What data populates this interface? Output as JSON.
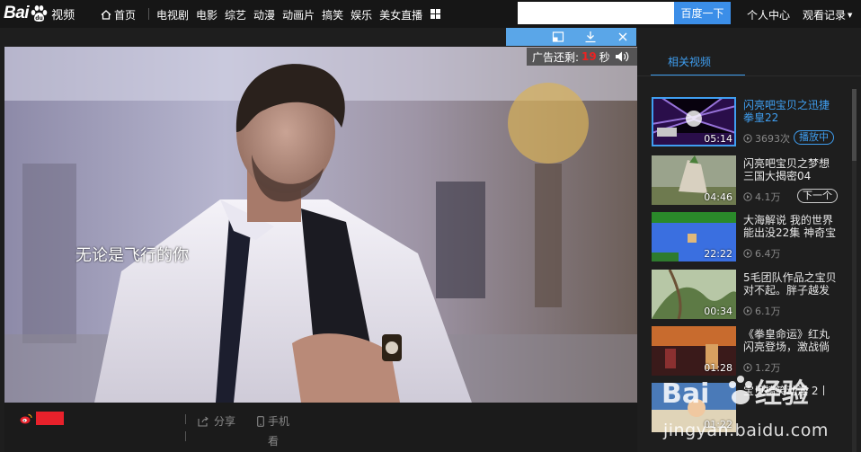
{
  "header": {
    "logo_text": "Bai",
    "logo_suffix": "视频",
    "home_label": "首页",
    "nav": [
      "电视剧",
      "电影",
      "综艺",
      "动漫",
      "动画片",
      "搞笑",
      "娱乐",
      "美女直播"
    ],
    "search_placeholder": "",
    "search_button": "百度一下",
    "user_center": "个人中心",
    "history": "观看记录"
  },
  "player": {
    "subtitle": "无论是飞行的你",
    "ad_label": "广告还剩:",
    "ad_seconds": "19",
    "ad_unit": "秒"
  },
  "player_bar": {
    "share": "分享",
    "phone_1": "手机",
    "phone_2": "看"
  },
  "panel": {
    "tab_label": "相关视频",
    "items": [
      {
        "title": "闪亮吧宝贝之迅捷拳皇22",
        "duration": "05:14",
        "views": "3693次",
        "badge": "播放中"
      },
      {
        "title": "闪亮吧宝贝之梦想三国大揭密04",
        "duration": "04:46",
        "views": "4.1万",
        "badge": "下一个"
      },
      {
        "title": "大海解说 我的世界能出没22集 神奇宝",
        "duration": "22:22",
        "views": "6.4万",
        "badge": ""
      },
      {
        "title": "5毛团队作品之宝贝对不起。胖子越发",
        "duration": "00:34",
        "views": "6.1万",
        "badge": ""
      },
      {
        "title": "《拳皇命运》红丸闪亮登场，激战倘",
        "duration": "01:28",
        "views": "1.2万",
        "badge": ""
      },
      {
        "title": "宝贝搞笑动漫 2丨",
        "duration": "01:22",
        "views": "",
        "badge": ""
      }
    ]
  },
  "watermark": {
    "text": "Baidu 经验",
    "url_text": "jingyan.baidu.com"
  },
  "colors": {
    "accent": "#3f9ef0",
    "search_button": "#3b8ee8",
    "mini_bar": "#5aa6e8",
    "ad_seconds": "#e22222",
    "weibo_red": "#e8212b"
  }
}
